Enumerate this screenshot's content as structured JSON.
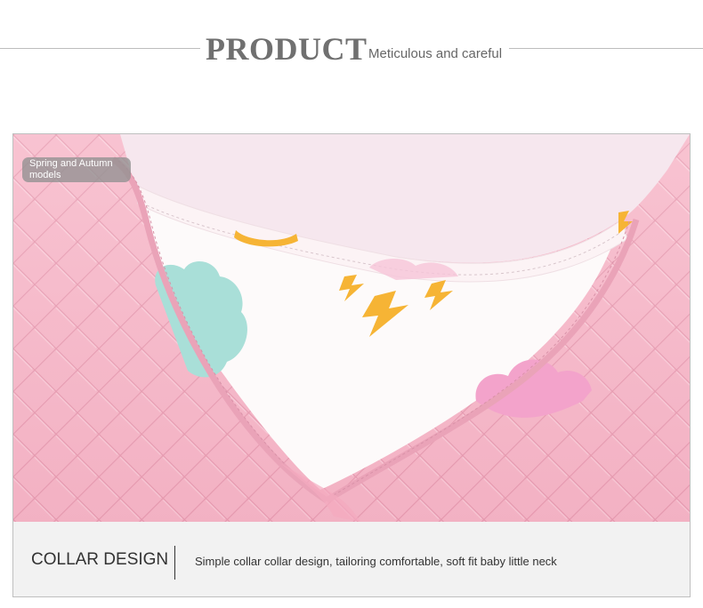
{
  "header": {
    "title": "PRODUCT",
    "subtitle": "Meticulous and careful"
  },
  "photo": {
    "badge": "Spring and Autumn models",
    "colors": {
      "quilted_pink": "#f7b8c9",
      "quilted_line": "#e99cb2",
      "lining": "#fbf6f6",
      "cloud_teal": "#a8ddd8",
      "cloud_pink": "#f3a2cc",
      "bolt_orange": "#f6b435"
    }
  },
  "caption": {
    "title": "COLLAR DESIGN",
    "text": "Simple collar collar design, tailoring comfortable, soft fit baby little neck"
  }
}
